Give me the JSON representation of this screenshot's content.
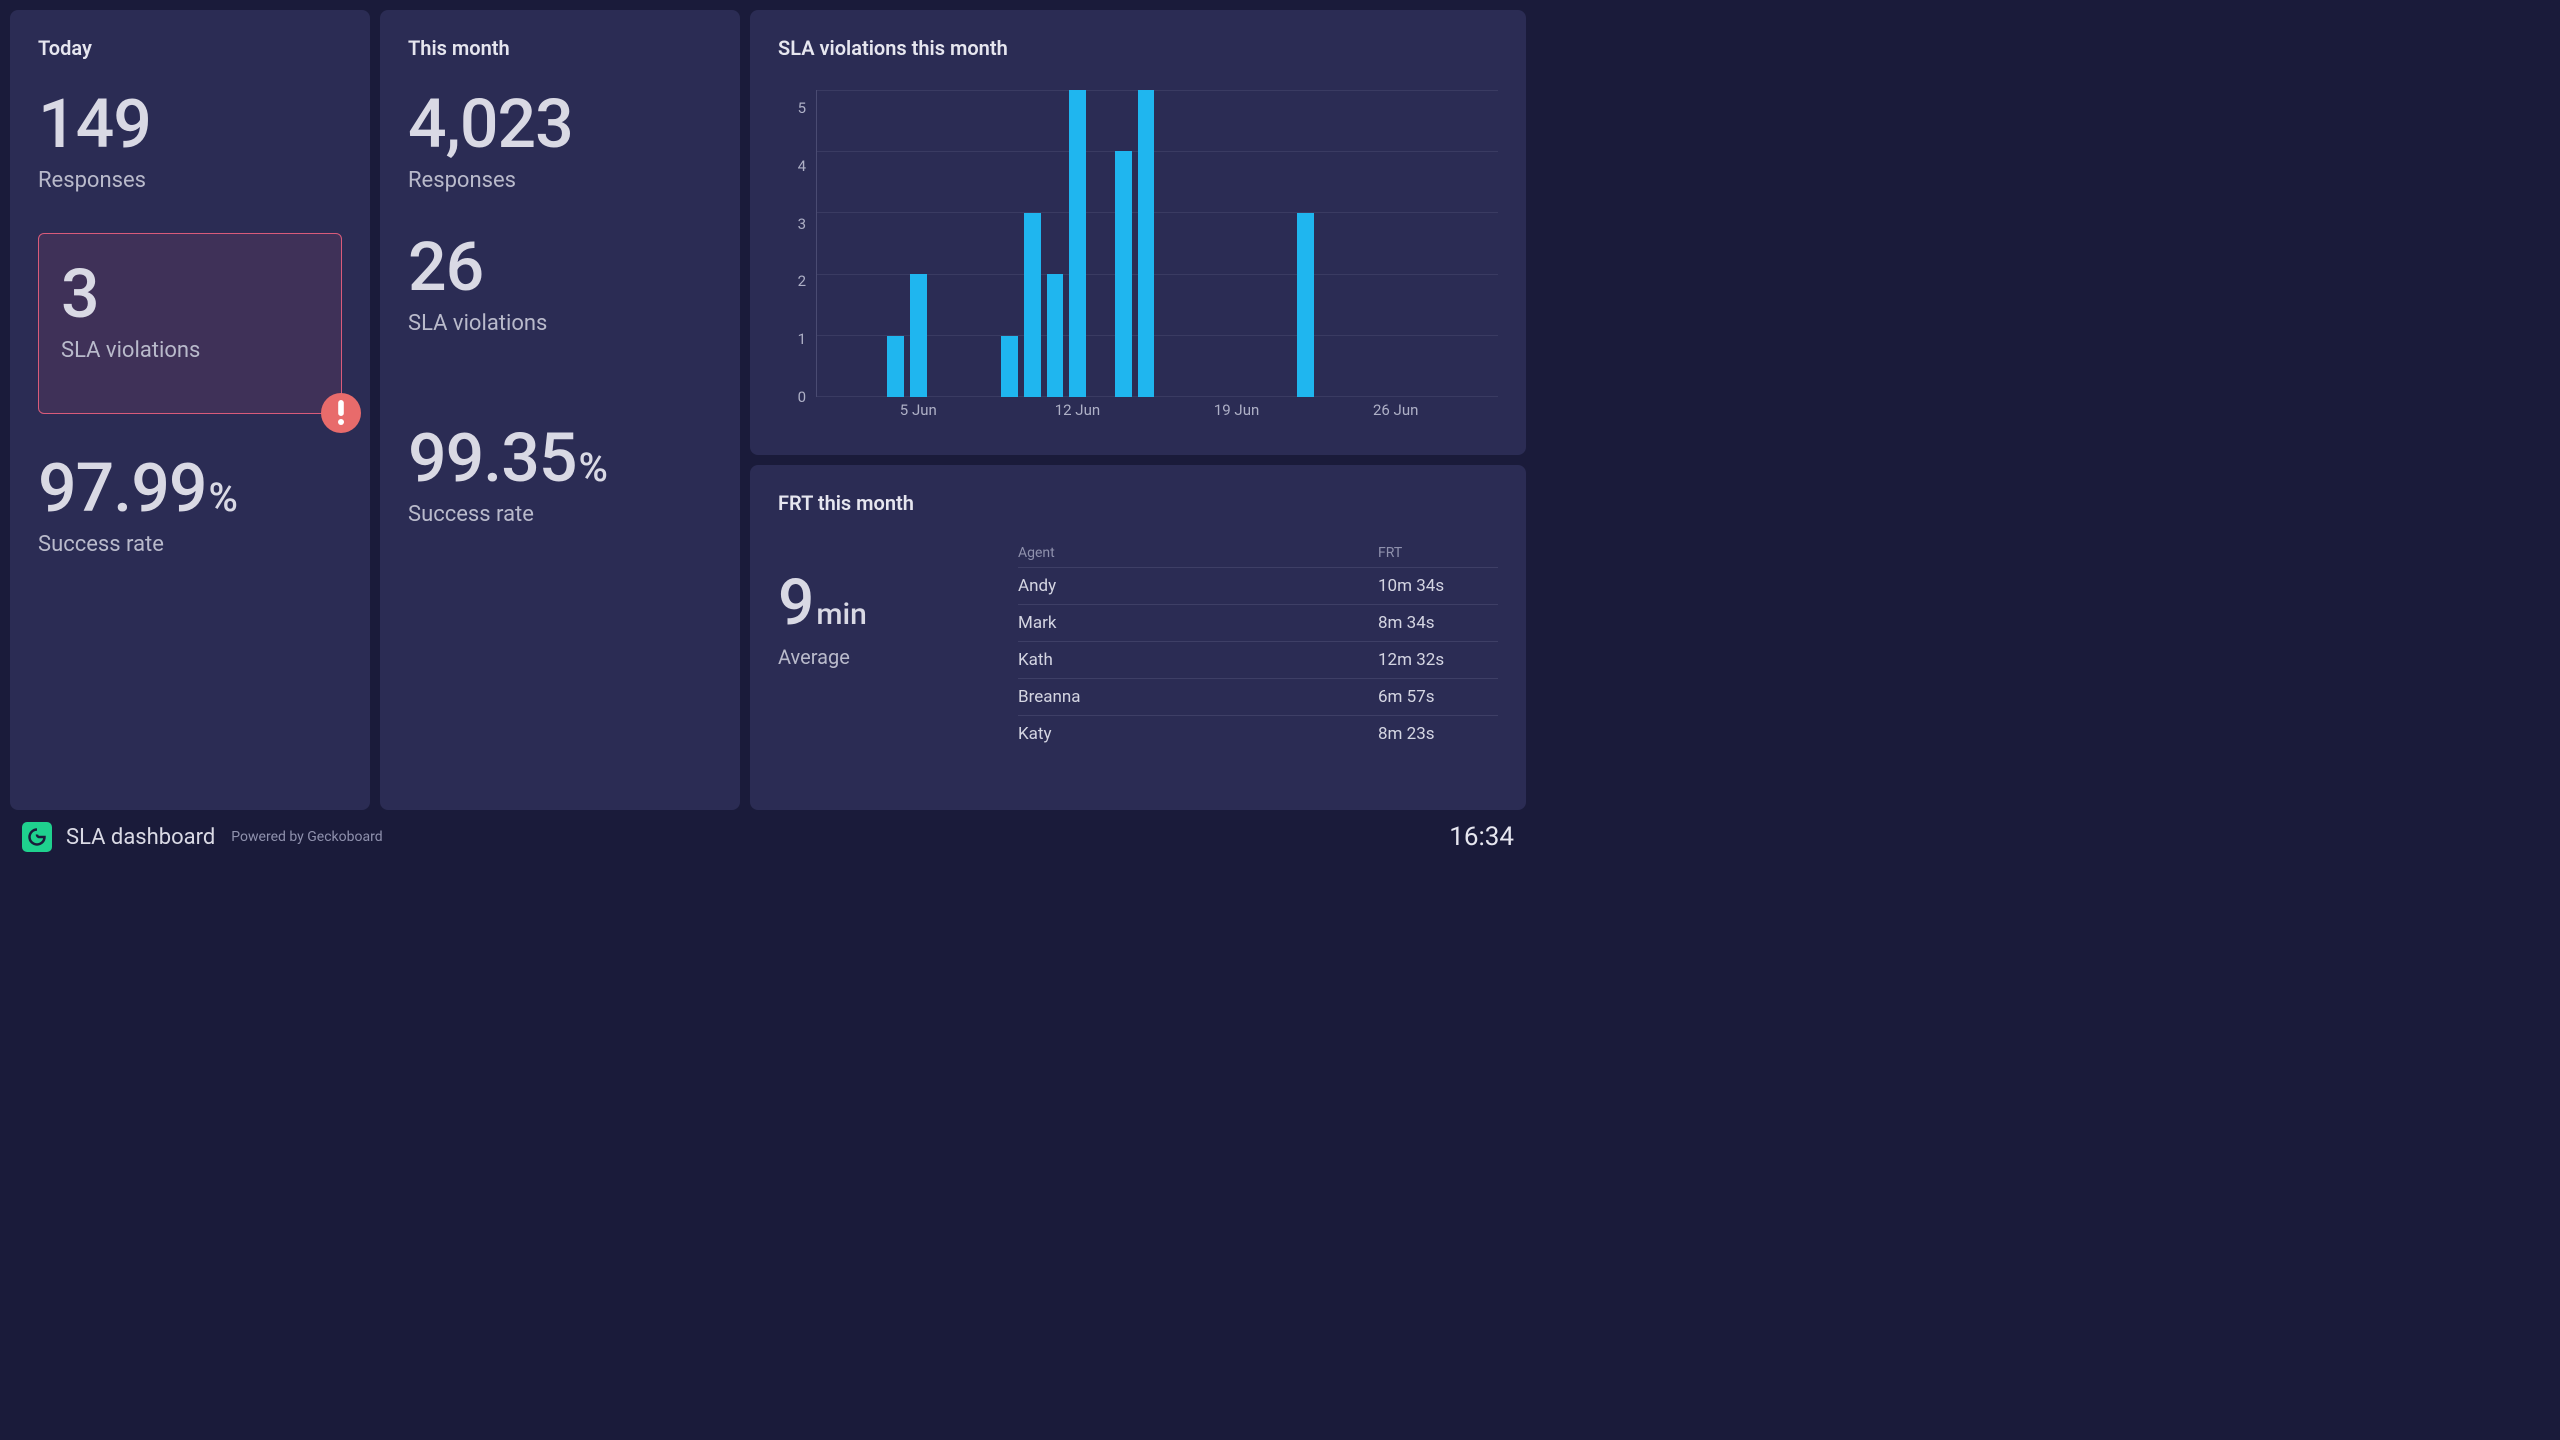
{
  "today": {
    "title": "Today",
    "responses_value": "149",
    "responses_label": "Responses",
    "sla_value": "3",
    "sla_label": "SLA violations",
    "success_value": "97.99",
    "success_unit": "%",
    "success_label": "Success rate"
  },
  "month": {
    "title": "This month",
    "responses_value": "4,023",
    "responses_label": "Responses",
    "sla_value": "26",
    "sla_label": "SLA violations",
    "success_value": "99.35",
    "success_unit": "%",
    "success_label": "Success rate"
  },
  "violations_chart_title": "SLA violations this month",
  "chart_data": {
    "type": "bar",
    "title": "SLA violations this month",
    "xlabel": "",
    "ylabel": "",
    "ylim": [
      0,
      5
    ],
    "yticks": [
      0,
      1,
      2,
      3,
      4,
      5
    ],
    "x_tick_labels": [
      "5 Jun",
      "12 Jun",
      "19 Jun",
      "26 Jun"
    ],
    "x_tick_positions": [
      5,
      12,
      19,
      26
    ],
    "categories": [
      1,
      2,
      3,
      4,
      5,
      6,
      7,
      8,
      9,
      10,
      11,
      12,
      13,
      14,
      15,
      16,
      17,
      18,
      19,
      20,
      21,
      22,
      23,
      24,
      25,
      26,
      27,
      28,
      29,
      30
    ],
    "values": [
      0,
      0,
      0,
      1,
      2,
      0,
      0,
      0,
      1,
      3,
      2,
      5,
      0,
      4,
      5,
      0,
      0,
      0,
      0,
      0,
      0,
      3,
      0,
      0,
      0,
      0,
      0,
      0,
      0,
      0
    ]
  },
  "frt": {
    "title": "FRT this month",
    "avg_value": "9",
    "avg_unit": "min",
    "avg_label": "Average",
    "col_agent": "Agent",
    "col_frt": "FRT",
    "rows": [
      {
        "agent": "Andy",
        "frt": "10m 34s"
      },
      {
        "agent": "Mark",
        "frt": "8m 34s"
      },
      {
        "agent": "Kath",
        "frt": "12m 32s"
      },
      {
        "agent": "Breanna",
        "frt": "6m 57s"
      },
      {
        "agent": "Katy",
        "frt": "8m 23s"
      }
    ]
  },
  "footer": {
    "title": "SLA dashboard",
    "powered": "Powered by Geckoboard",
    "clock": "16:34"
  }
}
